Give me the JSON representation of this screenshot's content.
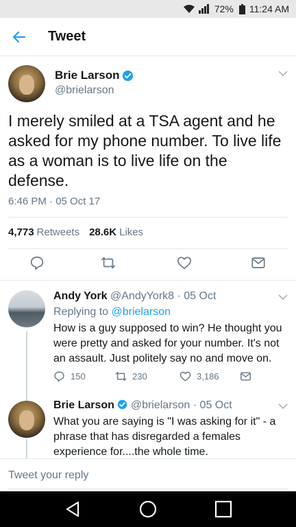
{
  "status_bar": {
    "battery": "72%",
    "time": "11:24 AM"
  },
  "header": {
    "title": "Tweet"
  },
  "tweet": {
    "display_name": "Brie Larson",
    "handle": "@brielarson",
    "text": "I merely smiled at a TSA agent and he asked for my phone number. To live life as a woman is to live life on the defense.",
    "timestamp": "6:46 PM · 05 Oct 17",
    "retweets_count": "4,773",
    "retweets_label": "Retweets",
    "likes_count": "28.6K",
    "likes_label": "Likes"
  },
  "replies": [
    {
      "display_name": "Andy York",
      "handle": "@AndyYork8",
      "date": "· 05 Oct",
      "replying_prefix": "Replying to",
      "replying_to": "@brielarson",
      "text": "How is a guy supposed to win? He thought you were pretty and asked for your number. It's not an assault. Just politely say no and move on.",
      "reply_count": "150",
      "retweet_count": "230",
      "like_count": "3,186"
    },
    {
      "display_name": "Brie Larson",
      "handle": "@brielarson",
      "date": "· 05 Oct",
      "text": "What you are saying is \"I was asking for it\"  - a phrase that has disregarded a females experience for....the whole time."
    }
  ],
  "compose": {
    "placeholder": "Tweet your reply"
  },
  "colors": {
    "accent": "#1da1f2",
    "secondary_text": "#657786",
    "divider": "#e1e8ed"
  },
  "icons": [
    "back-arrow-icon",
    "verified-icon",
    "reply-icon",
    "retweet-icon",
    "like-icon",
    "message-icon",
    "chevron-down-icon",
    "nav-back-icon",
    "nav-home-icon",
    "nav-recents-icon"
  ]
}
